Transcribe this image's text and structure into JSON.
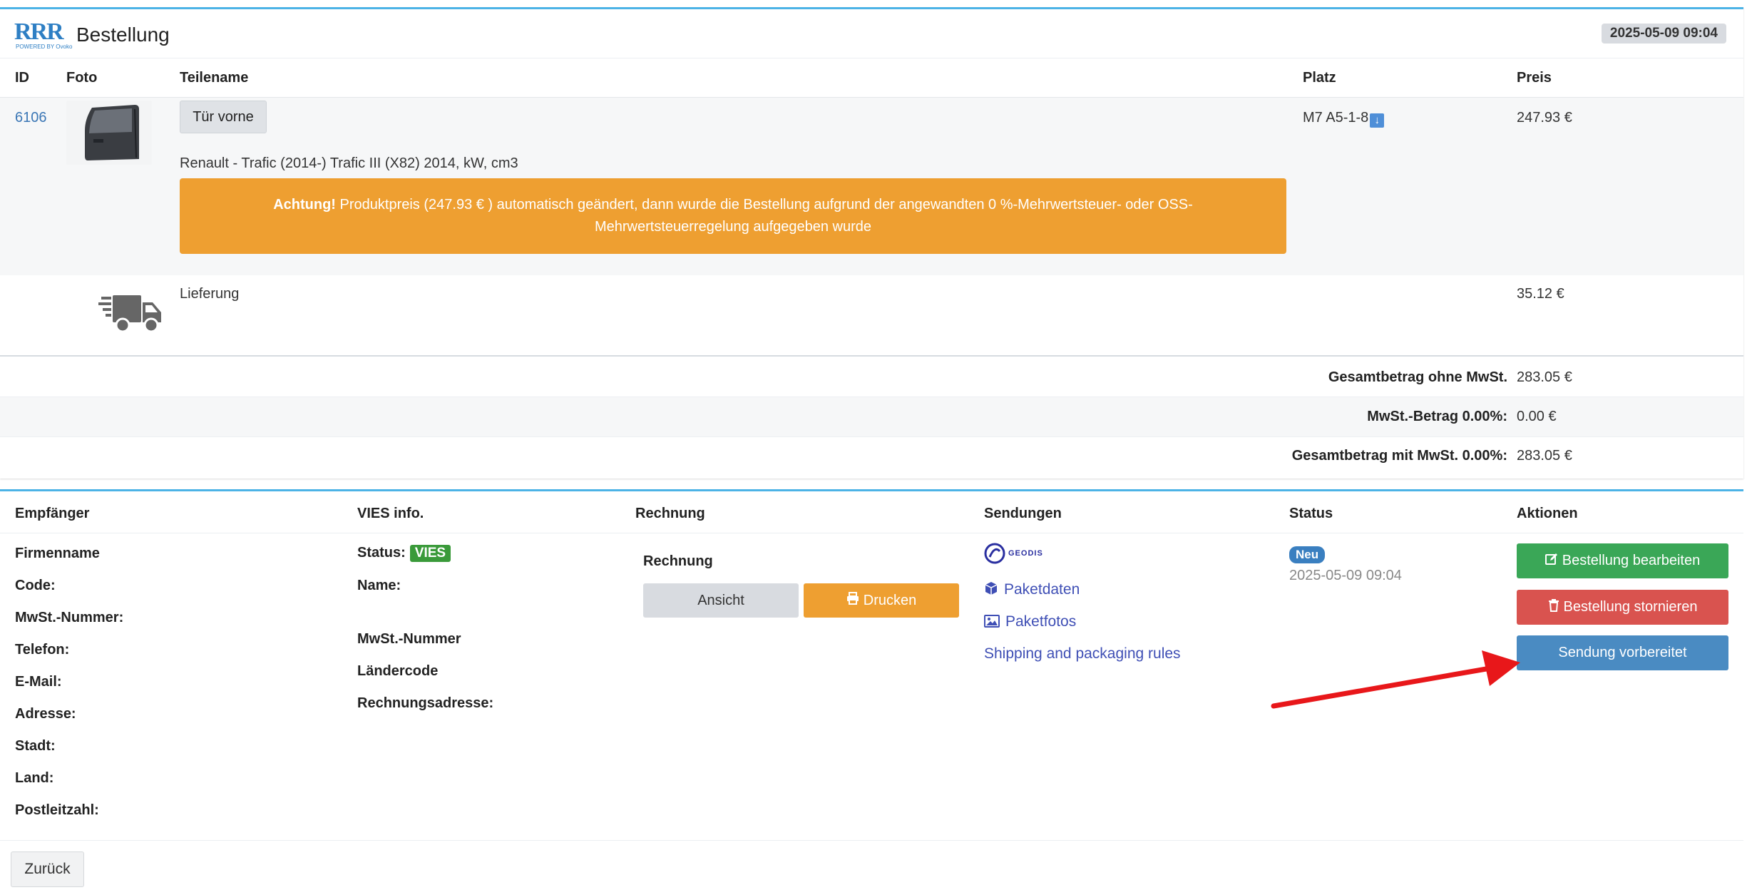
{
  "header": {
    "logo_text": "RRR",
    "logo_sub": "POWERED BY Ovoko",
    "title": "Bestellung",
    "date": "2025-05-09 09:04"
  },
  "order_table": {
    "columns": {
      "id": "ID",
      "foto": "Foto",
      "teilename": "Teilename",
      "platz": "Platz",
      "preis": "Preis"
    },
    "item": {
      "id": "6106",
      "part_name": "Tür vorne",
      "vehicle": "Renault - Trafic (2014-) Trafic III (X82) 2014, kW, cm3",
      "location": "M7 A5-1-8",
      "price": "247.93 €",
      "alert_strong": "Achtung!",
      "alert_line1": " Produktpreis (247.93 € ) automatisch geändert, dann wurde die Bestellung aufgrund der angewandten 0 %-Mehrwertsteuer- oder OSS-",
      "alert_line2": "Mehrwertsteuerregelung aufgegeben wurde"
    },
    "delivery": {
      "label": "Lieferung",
      "price": "35.12 €"
    },
    "totals": [
      {
        "label": "Gesamtbetrag ohne MwSt.",
        "value": "283.05 €"
      },
      {
        "label": "MwSt.-Betrag 0.00%:",
        "value": "0.00 €"
      },
      {
        "label": "Gesamtbetrag mit MwSt. 0.00%:",
        "value": "283.05 €"
      }
    ]
  },
  "details": {
    "columns": {
      "empfaenger": "Empfänger",
      "vies": "VIES info.",
      "rechnung": "Rechnung",
      "sendungen": "Sendungen",
      "status": "Status",
      "aktionen": "Aktionen"
    },
    "recipient_labels": [
      "Firmenname",
      "Code:",
      "MwSt.-Nummer:",
      "Telefon:",
      "E-Mail:",
      "Adresse:",
      "Stadt:",
      "Land:",
      "Postleitzahl:"
    ],
    "vies": {
      "status_label": "Status:",
      "status_badge": "VIES",
      "name_label": "Name:",
      "vat_label": "MwSt.-Nummer",
      "country_label": "Ländercode",
      "billing_label": "Rechnungsadresse:"
    },
    "invoice": {
      "title": "Rechnung",
      "view_label": "Ansicht",
      "print_label": "Drucken"
    },
    "shipments": {
      "carrier": "GEODIS",
      "package_data": "Paketdaten",
      "package_photos": "Paketfotos",
      "rules": "Shipping and packaging rules"
    },
    "status": {
      "badge": "Neu",
      "date": "2025-05-09 09:04"
    },
    "actions": {
      "edit": "Bestellung bearbeiten",
      "cancel": "Bestellung stornieren",
      "prepared": "Sendung vorbereitet"
    }
  },
  "footer": {
    "back_label": "Zurück"
  },
  "colors": {
    "accent_blue": "#4cb3e6",
    "alert_orange": "#ee9f31",
    "success_green": "#3aa757",
    "danger_red": "#d9534f",
    "info_blue": "#4a8bc2",
    "arrow_red": "#e8171a"
  }
}
